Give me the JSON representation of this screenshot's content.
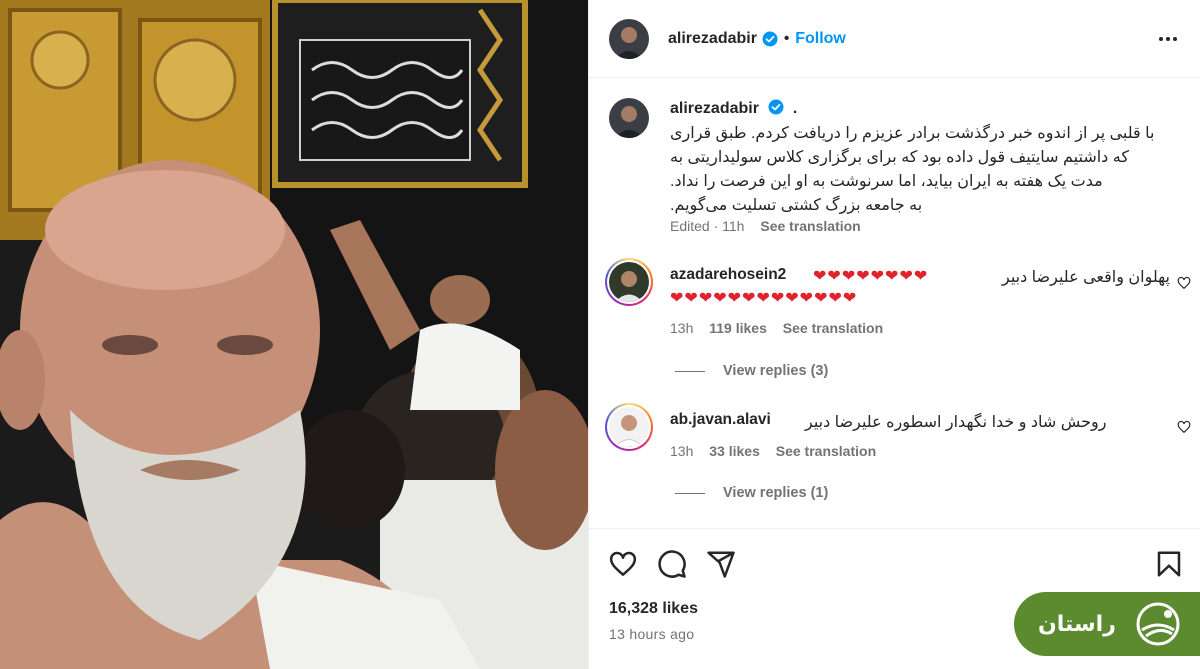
{
  "post": {
    "username": "alirezadabir",
    "follow_label": "Follow",
    "separator": "•"
  },
  "caption": {
    "username": "alirezadabir",
    "trailing": ".",
    "lines": [
      "با قلبی پر از اندوه خبر درگذشت برادر عزیزم را دریافت کردم. طبق قراری",
      "که داشتیم سایتیف قول داده بود که برای برگزاری کلاس سولیداریتی به",
      "مدت یک هفته به ایران بیاید، اما سرنوشت به او این فرصت را نداد.",
      "به جامعه بزرگ کشتی تسلیت می‌گویم."
    ],
    "edited": "Edited · 11h",
    "see_translation": "See translation"
  },
  "comments": [
    {
      "username": "azadarehosein2",
      "text": "پهلوان واقعی علیرضا دبیر",
      "hearts_line1": "❤❤❤❤❤❤❤❤",
      "hearts_line2": "❤❤❤❤❤❤❤❤❤❤❤❤❤",
      "time": "13h",
      "likes": "119 likes",
      "see_translation": "See translation",
      "view_replies": "View replies (3)"
    },
    {
      "username": "ab.javan.alavi",
      "text": "روحش شاد و خدا نگهدار اسطوره علیرضا دبیر",
      "time": "13h",
      "likes": "33 likes",
      "see_translation": "See translation",
      "view_replies": "View replies (1)"
    }
  ],
  "actions": {
    "likes": "16,328 likes",
    "time_ago": "13 hours ago"
  },
  "watermark": {
    "text": "راستان"
  },
  "colors": {
    "follow": "#0095f6",
    "verified": "#0095f6",
    "muted": "#737373",
    "heart": "#e0222d",
    "brand": "#5c8a2f"
  },
  "icons": [
    "verified-badge-icon",
    "more-options-icon",
    "like-icon",
    "comment-icon",
    "share-icon",
    "save-icon",
    "comment-like-icon",
    "brand-logo-icon"
  ]
}
